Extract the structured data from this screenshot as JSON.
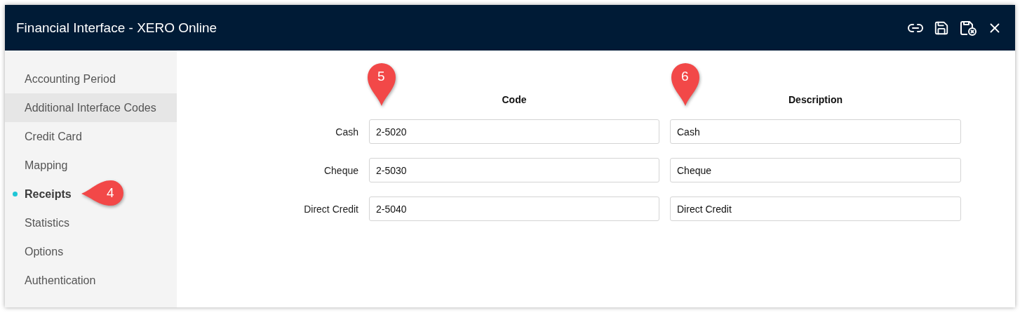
{
  "window": {
    "title": "Financial Interface - XERO Online"
  },
  "toolbar": [
    {
      "kind": "link"
    },
    {
      "kind": "save"
    },
    {
      "kind": "save-close"
    },
    {
      "kind": "close"
    }
  ],
  "sidebar": {
    "items": [
      {
        "label": "Accounting Period",
        "selected": false,
        "hovered": false
      },
      {
        "label": "Additional Interface Codes",
        "selected": false,
        "hovered": true
      },
      {
        "label": "Credit Card",
        "selected": false,
        "hovered": false
      },
      {
        "label": "Mapping",
        "selected": false,
        "hovered": false
      },
      {
        "label": "Receipts",
        "selected": true,
        "hovered": false
      },
      {
        "label": "Statistics",
        "selected": false,
        "hovered": false
      },
      {
        "label": "Options",
        "selected": false,
        "hovered": false
      },
      {
        "label": "Authentication",
        "selected": false,
        "hovered": false
      }
    ]
  },
  "table": {
    "columns": [
      "Code",
      "Description"
    ],
    "rows": [
      {
        "label": "Cash",
        "code": "2-5020",
        "description": "Cash"
      },
      {
        "label": "Cheque",
        "code": "2-5030",
        "description": "Cheque"
      },
      {
        "label": "Direct Credit",
        "code": "2-5040",
        "description": "Direct Credit"
      }
    ]
  },
  "callouts": [
    {
      "number": "4",
      "kind": "pointer"
    },
    {
      "number": "5",
      "kind": "pin"
    },
    {
      "number": "6",
      "kind": "pin"
    }
  ]
}
